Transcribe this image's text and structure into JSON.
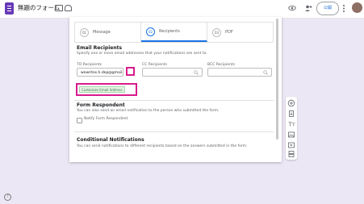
{
  "app": {
    "doc_title": "無題のフォーム",
    "publish_label": "公開"
  },
  "tabs": [
    {
      "num": "01",
      "label": "Message"
    },
    {
      "num": "02",
      "label": "Recipients"
    },
    {
      "num": "03",
      "label": "PDF"
    }
  ],
  "email_recipients": {
    "title": "Email Recipients",
    "description": "Specify one or more email addresses that your notifications are sent to.",
    "to_label": "TO Recipients",
    "to_value": "wewrites.h.dep@gmail...",
    "cc_label": "CC Recipients",
    "bcc_label": "BCC Recipients",
    "customize_button": "Customize Email Address"
  },
  "form_respondent": {
    "title": "Form Respondent",
    "description": "You can also send an email notification to the person who submitted the form.",
    "notify_label": "Notify Form Respondent"
  },
  "conditional": {
    "title": "Conditional Notifications",
    "description": "You can send notifications to different recipients based on the answers submitted in the form."
  },
  "colors": {
    "accent": "#1a73e8",
    "highlight": "#d81b8c",
    "brand": "#673ab7"
  },
  "icons": [
    "doc-icon",
    "folder-icon",
    "cloud-icon",
    "eye-icon",
    "person-add-icon",
    "more-icon",
    "search-icon",
    "add-circle-icon",
    "import-icon",
    "title-icon",
    "image-icon",
    "video-icon",
    "section-icon",
    "help-icon"
  ]
}
